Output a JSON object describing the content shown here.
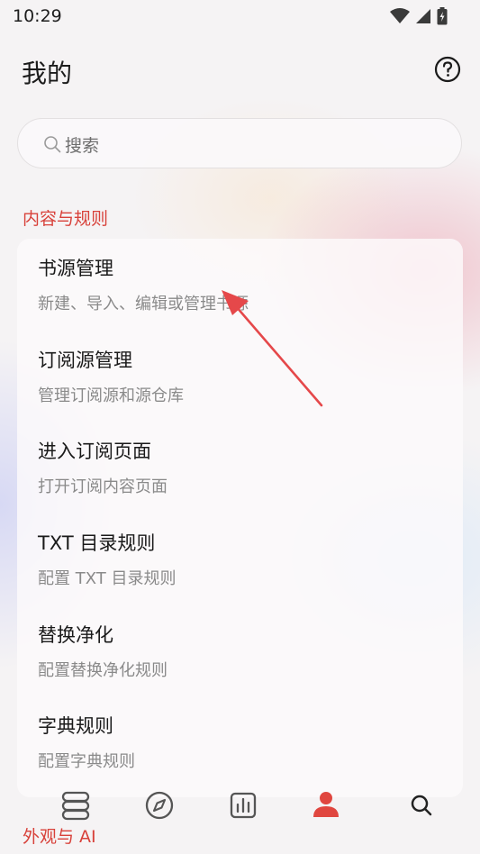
{
  "status": {
    "time": "10:29"
  },
  "header": {
    "title": "我的"
  },
  "search": {
    "placeholder": "搜索"
  },
  "sections": [
    {
      "title": "内容与规则",
      "items": [
        {
          "title": "书源管理",
          "subtitle": "新建、导入、编辑或管理书源"
        },
        {
          "title": "订阅源管理",
          "subtitle": "管理订阅源和源仓库"
        },
        {
          "title": "进入订阅页面",
          "subtitle": "打开订阅内容页面"
        },
        {
          "title": "TXT 目录规则",
          "subtitle": "配置 TXT 目录规则"
        },
        {
          "title": "替换净化",
          "subtitle": "配置替换净化规则"
        },
        {
          "title": "字典规则",
          "subtitle": "配置字典规则"
        }
      ]
    },
    {
      "title": "外观与 AI"
    }
  ],
  "bottom_nav": {
    "items": [
      {
        "icon": "bookshelf-icon"
      },
      {
        "icon": "compass-icon"
      },
      {
        "icon": "chart-icon"
      },
      {
        "icon": "person-icon",
        "active": true
      },
      {
        "icon": "search-icon"
      }
    ]
  },
  "colors": {
    "accent": "#e0463f",
    "section_title": "#d8413a",
    "arrow": "#e5484a"
  }
}
